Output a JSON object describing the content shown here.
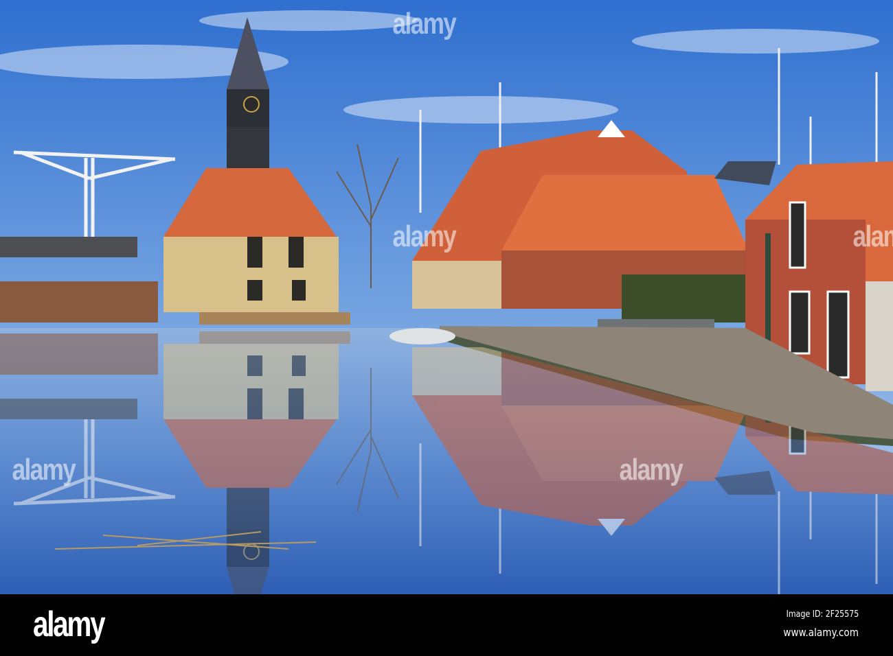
{
  "watermark": {
    "text": "alamy"
  },
  "footer": {
    "logo": "alamy",
    "image_id": "Image ID: 2F25575",
    "url": "www.alamy.com"
  },
  "colors": {
    "sky_top": "#2f6fcf",
    "sky_bottom": "#b8d2ee",
    "roof": "#d5673d",
    "brick": "#b5523a",
    "water": "#4a78c0"
  }
}
